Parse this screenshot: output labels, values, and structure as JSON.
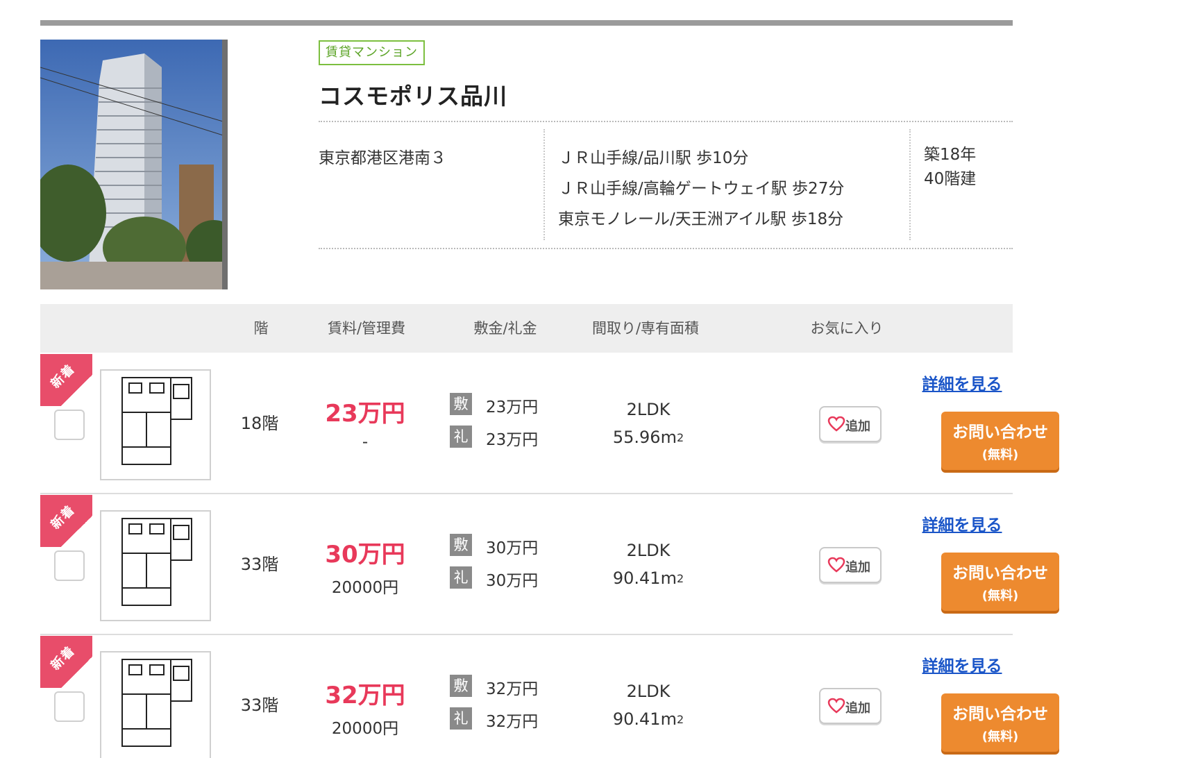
{
  "building": {
    "type_badge": "賃貸マンション",
    "name": "コスモポリス品川",
    "address": "東京都港区港南３",
    "stations": [
      "ＪＲ山手線/品川駅 歩10分",
      "ＪＲ山手線/高輪ゲートウェイ駅 歩27分",
      "東京モノレール/天王洲アイル駅 歩18分"
    ],
    "age": "築18年",
    "floors": "40階建"
  },
  "table": {
    "headers": {
      "floor": "階",
      "rent": "賃料/管理費",
      "deposit": "敷金/礼金",
      "layout": "間取り/専有面積",
      "favorite": "お気に入り"
    }
  },
  "listing_labels": {
    "new": "新着",
    "deposit_badge": "敷",
    "key_money_badge": "礼",
    "favorite_button": "追加",
    "detail_link": "詳細を見る",
    "inquiry_main": "お問い合わせ",
    "inquiry_sub": "(無料)",
    "area_unit": "m",
    "area_exp": "2"
  },
  "listings": [
    {
      "floor": "18階",
      "rent": "23万円",
      "management_fee": "-",
      "deposit": "23万円",
      "key_money": "23万円",
      "layout": "2LDK",
      "area": "55.96"
    },
    {
      "floor": "33階",
      "rent": "30万円",
      "management_fee": "20000円",
      "deposit": "30万円",
      "key_money": "30万円",
      "layout": "2LDK",
      "area": "90.41"
    },
    {
      "floor": "33階",
      "rent": "32万円",
      "management_fee": "20000円",
      "deposit": "32万円",
      "key_money": "32万円",
      "layout": "2LDK",
      "area": "90.41"
    }
  ],
  "colors": {
    "accent_red": "#e8395a",
    "badge_green": "#5ca427",
    "button_orange": "#ed8a2f",
    "link_blue": "#1a55c8"
  }
}
